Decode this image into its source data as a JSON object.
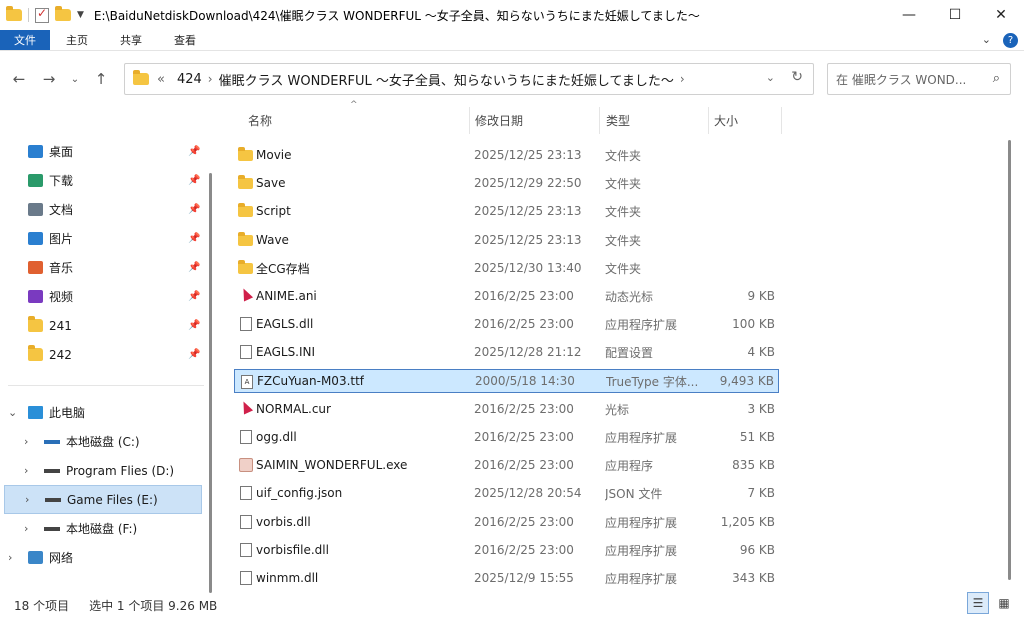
{
  "titlebar": {
    "path": "E:\\BaiduNetdiskDownload\\424\\催眠クラス WONDERFUL ～女子全員、知らないうちにまた妊娠してました～",
    "minimize": "—",
    "maximize": "☐",
    "close": "✕"
  },
  "ribbon": {
    "tabs": [
      "文件",
      "主页",
      "共享",
      "查看"
    ],
    "collapse": "⌄",
    "help": "?"
  },
  "nav_buttons": {
    "back": "←",
    "forward": "→",
    "recent": "⌄",
    "up": "↑"
  },
  "address": {
    "overflow": "«",
    "crumbs": [
      "424",
      "催眠クラス WONDERFUL ～女子全員、知らないうちにまた妊娠してました～"
    ],
    "separator": "›",
    "dropdown": "⌄",
    "refresh": "↻"
  },
  "search": {
    "placeholder": "在 催眠クラス WOND...",
    "icon": "⌕"
  },
  "navpane": {
    "quick_access": [
      {
        "label": "桌面",
        "icon": "desktop-icon",
        "color": "#2a7fd0"
      },
      {
        "label": "下载",
        "icon": "download-icon",
        "color": "#2a9a6a"
      },
      {
        "label": "文档",
        "icon": "document-icon",
        "color": "#6a7a8a"
      },
      {
        "label": "图片",
        "icon": "pictures-icon",
        "color": "#2a7fd0"
      },
      {
        "label": "音乐",
        "icon": "music-icon",
        "color": "#e06030"
      },
      {
        "label": "视频",
        "icon": "video-icon",
        "color": "#7a3ac0"
      },
      {
        "label": "241",
        "icon": "folder-icon",
        "color": "#f5c542"
      },
      {
        "label": "242",
        "icon": "folder-icon",
        "color": "#f5c542"
      }
    ],
    "pin": "📌",
    "this_pc": "此电脑",
    "drives": [
      {
        "label": "本地磁盘 (C:)"
      },
      {
        "label": "Program Flies (D:)"
      },
      {
        "label": "Game Files (E:)"
      },
      {
        "label": "本地磁盘 (F:)"
      }
    ],
    "network": "网络",
    "expander_open": "⌄",
    "expander_closed": "›"
  },
  "columns": {
    "name": "名称",
    "date": "修改日期",
    "type": "类型",
    "size": "大小",
    "sort_arrow": "^"
  },
  "files": [
    {
      "name": "Movie",
      "date": "2025/12/25 23:13",
      "type": "文件夹",
      "size": "",
      "icon": "folder"
    },
    {
      "name": "Save",
      "date": "2025/12/29 22:50",
      "type": "文件夹",
      "size": "",
      "icon": "folder"
    },
    {
      "name": "Script",
      "date": "2025/12/25 23:13",
      "type": "文件夹",
      "size": "",
      "icon": "folder"
    },
    {
      "name": "Wave",
      "date": "2025/12/25 23:13",
      "type": "文件夹",
      "size": "",
      "icon": "folder"
    },
    {
      "name": "全CG存档",
      "date": "2025/12/30 13:40",
      "type": "文件夹",
      "size": "",
      "icon": "folder"
    },
    {
      "name": "ANIME.ani",
      "date": "2016/2/25 23:00",
      "type": "动态光标",
      "size": "9 KB",
      "icon": "cursor"
    },
    {
      "name": "EAGLS.dll",
      "date": "2016/2/25 23:00",
      "type": "应用程序扩展",
      "size": "100 KB",
      "icon": "doc"
    },
    {
      "name": "EAGLS.INI",
      "date": "2025/12/28 21:12",
      "type": "配置设置",
      "size": "4 KB",
      "icon": "doc"
    },
    {
      "name": "FZCuYuan-M03.ttf",
      "date": "2000/5/18 14:30",
      "type": "TrueType 字体...",
      "size": "9,493 KB",
      "icon": "font"
    },
    {
      "name": "NORMAL.cur",
      "date": "2016/2/25 23:00",
      "type": "光标",
      "size": "3 KB",
      "icon": "cursor"
    },
    {
      "name": "ogg.dll",
      "date": "2016/2/25 23:00",
      "type": "应用程序扩展",
      "size": "51 KB",
      "icon": "doc"
    },
    {
      "name": "SAIMIN_WONDERFUL.exe",
      "date": "2016/2/25 23:00",
      "type": "应用程序",
      "size": "835 KB",
      "icon": "app"
    },
    {
      "name": "uif_config.json",
      "date": "2025/12/28 20:54",
      "type": "JSON 文件",
      "size": "7 KB",
      "icon": "doc"
    },
    {
      "name": "vorbis.dll",
      "date": "2016/2/25 23:00",
      "type": "应用程序扩展",
      "size": "1,205 KB",
      "icon": "doc"
    },
    {
      "name": "vorbisfile.dll",
      "date": "2016/2/25 23:00",
      "type": "应用程序扩展",
      "size": "96 KB",
      "icon": "doc"
    },
    {
      "name": "winmm.dll",
      "date": "2025/12/9 15:55",
      "type": "应用程序扩展",
      "size": "343 KB",
      "icon": "doc"
    }
  ],
  "status": {
    "count": "18 个项目",
    "selected": "选中 1 个项目  9.26 MB",
    "details_view": "☰",
    "large_icons_view": "▦"
  }
}
